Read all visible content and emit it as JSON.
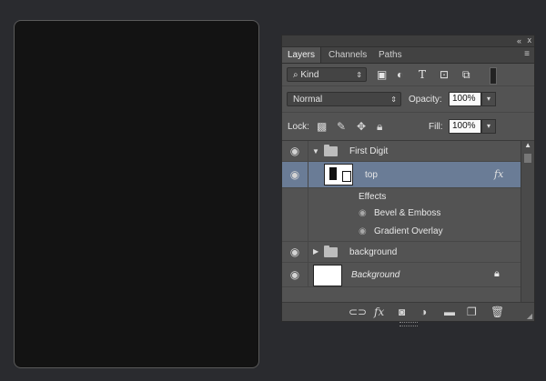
{
  "panel": {
    "tabs": [
      {
        "label": "Layers",
        "active": true
      },
      {
        "label": "Channels",
        "active": false
      },
      {
        "label": "Paths",
        "active": false
      }
    ],
    "top_controls": {
      "collapse": "«",
      "close": "x"
    },
    "filter": {
      "kind_label": "Kind",
      "kind_icon": "search-icon"
    },
    "blend": {
      "mode": "Normal",
      "opacity_label": "Opacity:",
      "opacity_value": "100%"
    },
    "lock": {
      "label": "Lock:",
      "fill_label": "Fill:",
      "fill_value": "100%"
    },
    "layers": [
      {
        "name": "First Digit",
        "type": "group",
        "expanded": true
      },
      {
        "name": "top",
        "type": "layer",
        "selected": true,
        "fx": "fx"
      },
      {
        "name": "Effects",
        "type": "effects-header"
      },
      {
        "name": "Bevel & Emboss",
        "type": "effect"
      },
      {
        "name": "Gradient Overlay",
        "type": "effect"
      },
      {
        "name": "background",
        "type": "group",
        "expanded": false
      },
      {
        "name": "Background",
        "type": "background",
        "locked": true
      }
    ]
  },
  "colors": {
    "selected_row": "#6a7c96",
    "panel_bg": "#535353",
    "canvas_bg": "#131313"
  }
}
